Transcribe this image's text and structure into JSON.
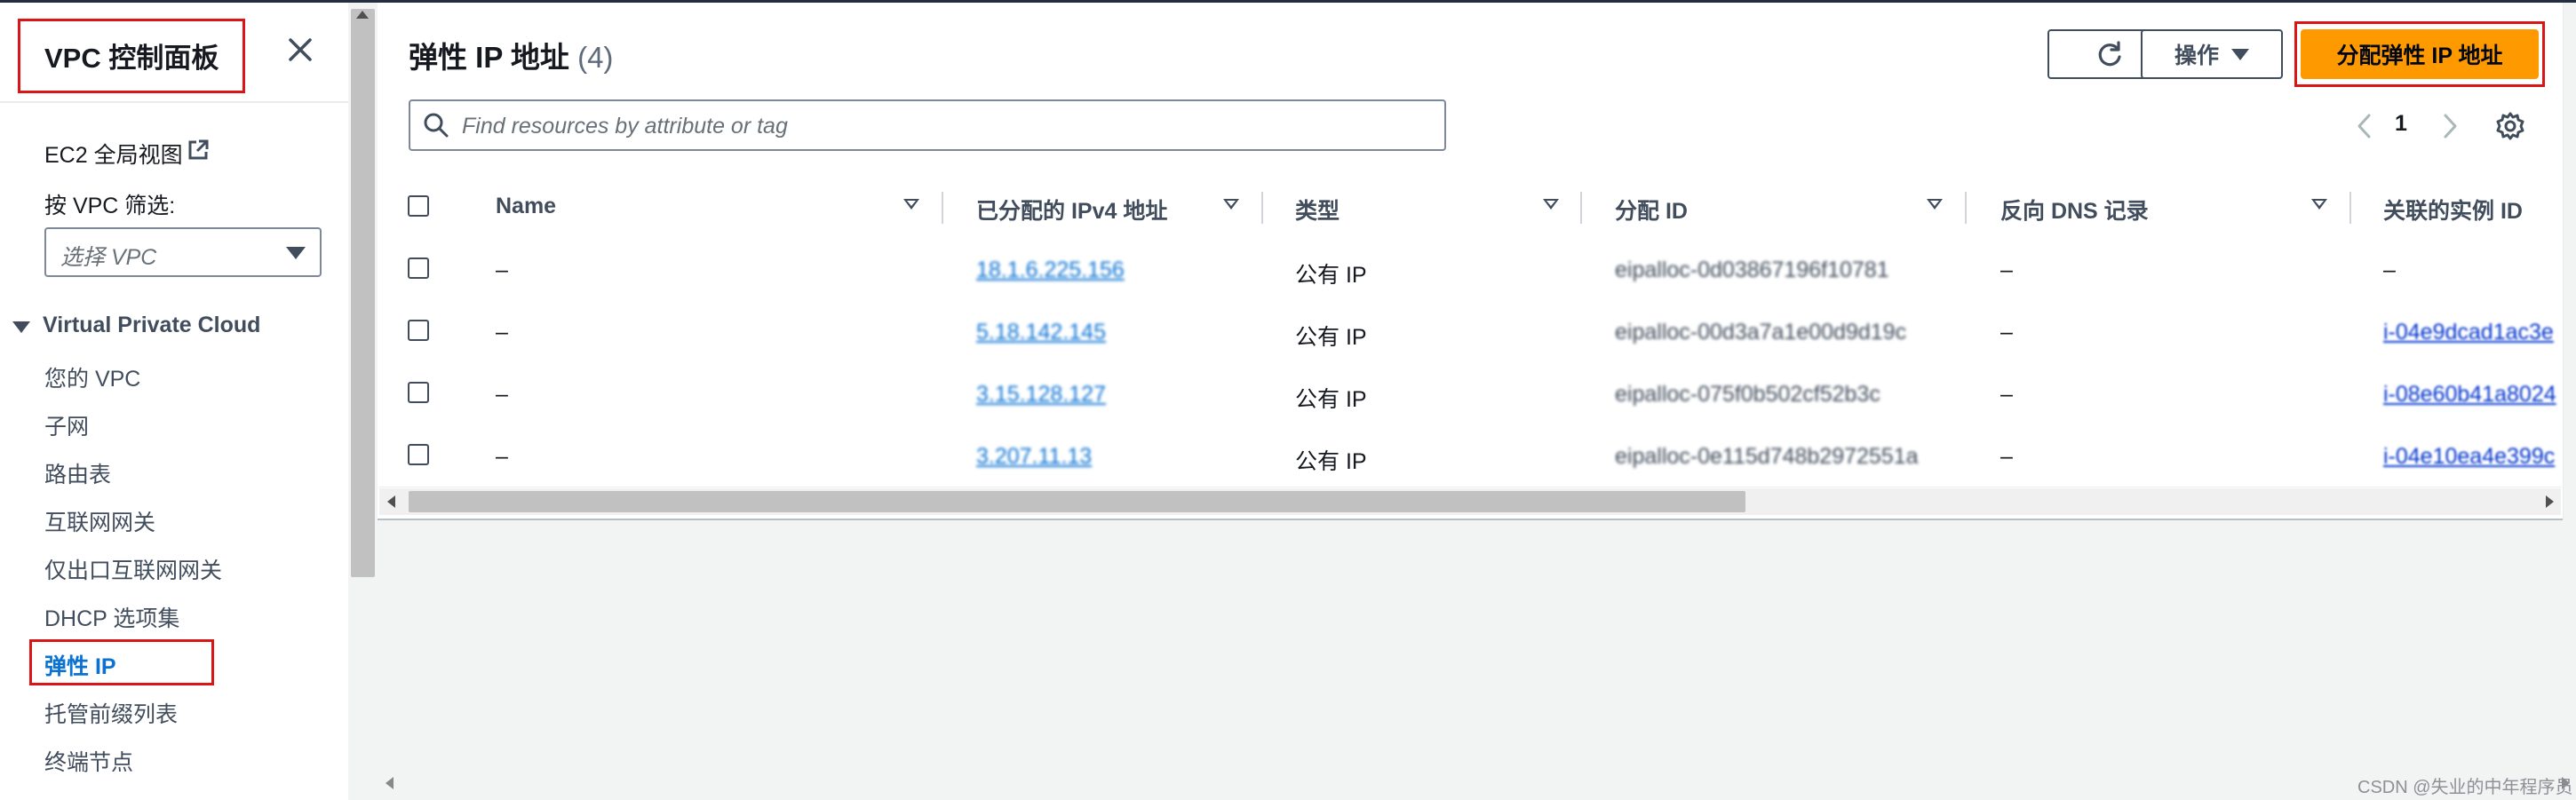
{
  "sidebar": {
    "title": "VPC 控制面板",
    "global_view_link": "EC2 全局视图",
    "filter_label": "按 VPC 筛选:",
    "filter_placeholder": "选择 VPC",
    "section_label": "Virtual Private Cloud",
    "items": [
      {
        "label": "您的 VPC"
      },
      {
        "label": "子网"
      },
      {
        "label": "路由表"
      },
      {
        "label": "互联网网关"
      },
      {
        "label": "仅出口互联网网关"
      },
      {
        "label": "DHCP 选项集"
      },
      {
        "label": "弹性 IP",
        "active": true
      },
      {
        "label": "托管前缀列表"
      },
      {
        "label": "终端节点"
      }
    ]
  },
  "header": {
    "title": "弹性 IP 地址",
    "count": "(4)",
    "actions_label": "操作",
    "allocate_label": "分配弹性 IP 地址"
  },
  "search": {
    "placeholder": "Find resources by attribute or tag"
  },
  "pagination": {
    "current_page": "1"
  },
  "table": {
    "columns": [
      "Name",
      "已分配的 IPv4 地址",
      "类型",
      "分配 ID",
      "反向 DNS 记录",
      "关联的实例 ID"
    ],
    "rows": [
      {
        "name": "–",
        "ip": "18.1.6.225.156",
        "type": "公有 IP",
        "alloc_id": "eipalloc-0d03867196f10781",
        "dns": "–",
        "instance": "–"
      },
      {
        "name": "–",
        "ip": "5.18.142.145",
        "type": "公有 IP",
        "alloc_id": "eipalloc-00d3a7a1e00d9d19c",
        "dns": "–",
        "instance": "i-04e9dcad1ac3e"
      },
      {
        "name": "–",
        "ip": "3.15.128.127",
        "type": "公有 IP",
        "alloc_id": "eipalloc-075f0b502cf52b3c",
        "dns": "–",
        "instance": "i-08e60b41a8024"
      },
      {
        "name": "–",
        "ip": "3.207.11.13",
        "type": "公有 IP",
        "alloc_id": "eipalloc-0e115d748b2972551a",
        "dns": "–",
        "instance": "i-04e10ea4e399c"
      }
    ]
  },
  "watermark": "CSDN @失业的中年程序员",
  "colors": {
    "primary": "#ff9900",
    "link": "#0972d3",
    "highlight_box": "#d91515"
  }
}
